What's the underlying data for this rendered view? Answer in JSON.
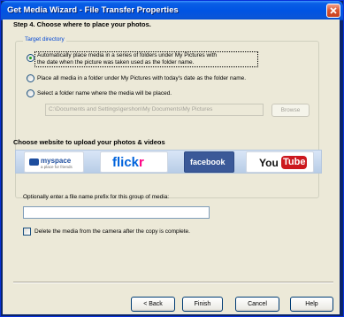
{
  "window": {
    "title": "Get Media Wizard - File Transfer Properties"
  },
  "step": {
    "title": "Step 4.  Choose where to place your photos."
  },
  "target_directory": {
    "label": "Target directory",
    "options": [
      {
        "line1": "Automatically place media in a series of folders under My Pictures with",
        "line2": "the date when the picture was taken used as the folder name.",
        "checked": true
      },
      {
        "line1": "Place all media in a folder under My Pictures with today's date as the folder name.",
        "checked": false
      },
      {
        "line1": "Select a folder name where the media will be placed.",
        "checked": false
      }
    ],
    "folder_path": "C:\\Documents and Settings\\gershon\\My Documents\\My Pictures",
    "browse_label": "Browse"
  },
  "upload": {
    "title": "Choose website to upload your photos & videos",
    "sites": {
      "myspace": {
        "name": "myspace",
        "tagline": "a place for friends"
      },
      "flickr": {
        "part1": "flick",
        "part2": "r"
      },
      "facebook": {
        "name": "facebook"
      },
      "youtube": {
        "part1": "You",
        "part2": "Tube"
      }
    }
  },
  "prefix": {
    "label": "Optionally enter a file name prefix for this group of media:",
    "value": ""
  },
  "delete_option": {
    "label": "Delete the media from the camera after the copy is complete.",
    "checked": false
  },
  "buttons": {
    "back": "< Back",
    "finish": "Finish",
    "cancel": "Cancel",
    "help": "Help"
  },
  "colors": {
    "titlebar": "#0054e3",
    "group_label": "#0046d5",
    "facebook": "#3b5998",
    "youtube_red": "#cc181e",
    "flickr_blue": "#0063dc",
    "flickr_pink": "#ff0084"
  }
}
